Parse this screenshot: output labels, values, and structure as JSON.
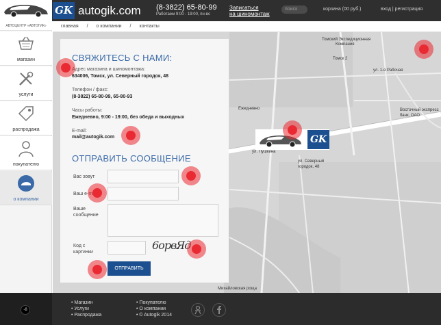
{
  "header": {
    "brand_short": "GK",
    "brand": "autogik.com",
    "phone": "(8-3822) 65-80-99",
    "hours": "Работаем 9:00 - 19:00, пн-вс",
    "book_line1": "Записаться",
    "book_line2": "на шиномонтаж",
    "search_placeholder": "поиск",
    "cart": "корзина  (00 руб.)",
    "login": "вход  |  регистрация"
  },
  "sidebar": {
    "title": "АВТОЦЕНТР «АВТОГИК»",
    "items": [
      {
        "label": "магазин"
      },
      {
        "label": "услуги"
      },
      {
        "label": "распродажа"
      },
      {
        "label": "покупателю"
      },
      {
        "label": "о компании"
      }
    ]
  },
  "breadcrumbs": [
    "главная",
    "/",
    "о компании",
    "/",
    "контакты"
  ],
  "contact": {
    "title": "СВЯЖИТЕСЬ С НАМИ:",
    "address_label": "Адрес магазина и шиномонтажа:",
    "address": "634006, Томск, ул. Северный городок, 48",
    "phone_label": "Телефон / факс:",
    "phone": "(8-3822) 65-80-99, 65-80-93",
    "hours_label": "Часы работы:",
    "hours": "Ежедневно, 9:00 - 19:00, без обеда и выходных",
    "email_label": "E-mail:",
    "email": "mail@autogik.com"
  },
  "form": {
    "title": "ОТПРАВИТЬ СООБЩЕНИЕ",
    "name_label": "Вас зовут",
    "email_label": "Ваш e-mail",
    "message_label_1": "Ваше",
    "message_label_2": "сообщение",
    "captcha_label_1": "Код с",
    "captcha_label_2": "картинки",
    "captcha_text": "6орвЯд",
    "submit": "ОТПРАВИТЬ"
  },
  "map": {
    "labels": {
      "l1": "Томский Экспедиционная",
      "l2": "Компания",
      "l3": "Томск 2",
      "l4": "ул. Пушкина",
      "l5": "ул. Северный",
      "l6": "городок, 48",
      "l7": "Восточный экспресс",
      "l8": "банк, ОАО",
      "l9": "Михайловская роща",
      "l10": "ул. 1-я Рабочая",
      "l11": "Ежедневно"
    },
    "sign_logo": "GK"
  },
  "footer": {
    "col1": [
      "Магазин",
      "Услуги",
      "Распродажа"
    ],
    "col2": [
      "Покупателю",
      "О компании",
      "© Autogik 2014"
    ],
    "bottom_logo": "-8"
  },
  "colors": {
    "accent": "#1c4f8f",
    "title_blue": "#3a6aa8",
    "marker": "#ea2a33"
  }
}
